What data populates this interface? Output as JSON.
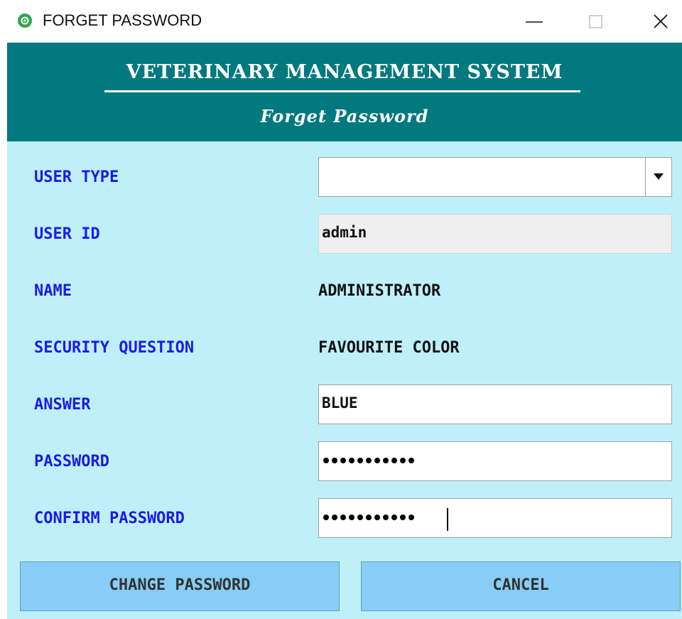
{
  "window": {
    "title": "FORGET PASSWORD",
    "icon": "app-logo-icon",
    "controls": [
      "minimize-icon",
      "maximize-icon",
      "close-icon"
    ]
  },
  "header": {
    "title": "VETERINARY MANAGEMENT SYSTEM",
    "subtitle": "Forget Password"
  },
  "form": {
    "user_type": {
      "label": "USER TYPE",
      "value": ""
    },
    "user_id": {
      "label": "USER ID",
      "value": "admin"
    },
    "name": {
      "label": "NAME",
      "value": "ADMINISTRATOR"
    },
    "security_question": {
      "label": "SECURITY QUESTION",
      "value": "FAVOURITE COLOR"
    },
    "answer": {
      "label": "ANSWER",
      "value": "BLUE"
    },
    "password": {
      "label": "PASSWORD",
      "masked_length": 11
    },
    "confirm_password": {
      "label": "CONFIRM PASSWORD",
      "masked_length": 11
    }
  },
  "buttons": {
    "change_password": "CHANGE PASSWORD",
    "cancel": "CANCEL"
  },
  "colors": {
    "header_bg": "#02787f",
    "form_bg": "#bff0fa",
    "label": "#1a1aee",
    "button_bg": "#87cdf5"
  }
}
